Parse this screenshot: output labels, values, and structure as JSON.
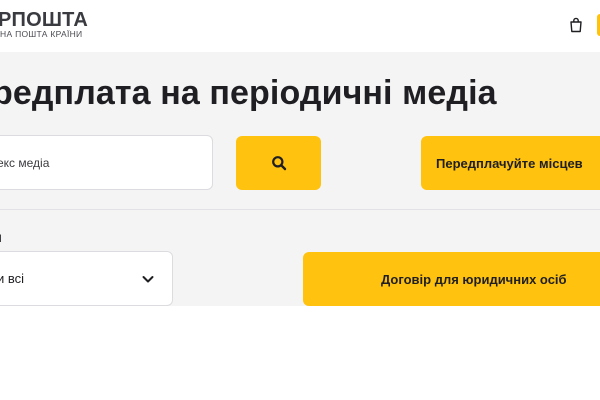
{
  "header": {
    "logo_title": "РПОШТА",
    "logo_subtitle": "НА ПОШТА КРАЇНИ",
    "cart_icon": "shopping-bag-icon",
    "accent_color": "#ffc20e"
  },
  "main": {
    "title": "редплата на періодичні медіа",
    "search": {
      "placeholder": "екс медіа",
      "button_icon": "search-icon"
    },
    "promo_button_label": "Передплачуйте місцев",
    "filter": {
      "label": "и",
      "selected": "и всі",
      "chevron_icon": "chevron-down-icon"
    },
    "contract_button_label": "Договір для юридичних осіб"
  },
  "colors": {
    "accent": "#ffc20e",
    "page_background": "#f4f4f5",
    "text": "#1f1f23"
  }
}
